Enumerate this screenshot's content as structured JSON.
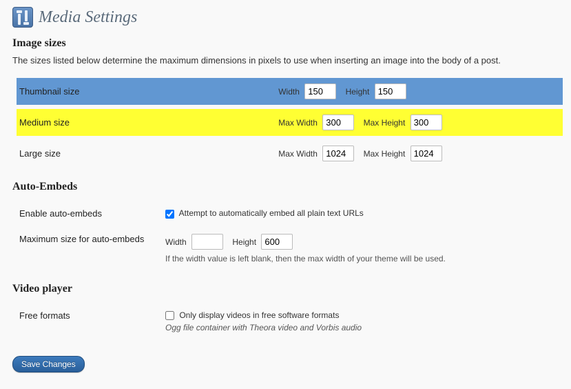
{
  "header": {
    "title": "Media Settings"
  },
  "sections": {
    "image_sizes": {
      "heading": "Image sizes",
      "desc": "The sizes listed below determine the maximum dimensions in pixels to use when inserting an image into the body of a post.",
      "thumbnail": {
        "label": "Thumbnail size",
        "width_label": "Width",
        "width": "150",
        "height_label": "Height",
        "height": "150"
      },
      "medium": {
        "label": "Medium size",
        "maxw_label": "Max Width",
        "maxw": "300",
        "maxh_label": "Max Height",
        "maxh": "300"
      },
      "large": {
        "label": "Large size",
        "maxw_label": "Max Width",
        "maxw": "1024",
        "maxh_label": "Max Height",
        "maxh": "1024"
      }
    },
    "auto_embeds": {
      "heading": "Auto-Embeds",
      "enable": {
        "label": "Enable auto-embeds",
        "checkbox_label": "Attempt to automatically embed all plain text URLs",
        "checked": true
      },
      "max_size": {
        "label": "Maximum size for auto-embeds",
        "width_label": "Width",
        "width": "",
        "height_label": "Height",
        "height": "600",
        "help": "If the width value is left blank, then the max width of your theme will be used."
      }
    },
    "video": {
      "heading": "Video player",
      "free": {
        "label": "Free formats",
        "checkbox_label": "Only display videos in free software formats",
        "checked": false,
        "note": "Ogg file container with Theora video and Vorbis audio"
      }
    }
  },
  "actions": {
    "save": "Save Changes"
  }
}
